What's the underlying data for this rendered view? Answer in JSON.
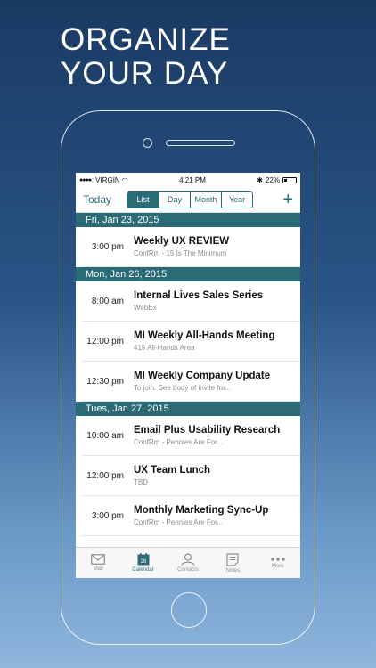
{
  "promo": {
    "line1": "ORGANIZE",
    "line2": "YOUR DAY"
  },
  "status": {
    "carrier": "VIRGIN",
    "time": "4:21 PM",
    "battery": "22%"
  },
  "toolbar": {
    "today": "Today",
    "views": [
      {
        "label": "List",
        "active": true
      },
      {
        "label": "Day",
        "active": false
      },
      {
        "label": "Month",
        "active": false
      },
      {
        "label": "Year",
        "active": false
      }
    ],
    "add": "+"
  },
  "days": [
    {
      "header": "Fri, Jan 23, 2015",
      "events": [
        {
          "time": "3:00 pm",
          "title": "Weekly UX REVIEW",
          "sub": "ConfRm - 15 Is The Minimum"
        }
      ]
    },
    {
      "header": "Mon, Jan 26, 2015",
      "events": [
        {
          "time": "8:00 am",
          "title": "Internal Lives Sales Series",
          "sub": "WebEx"
        },
        {
          "time": "12:00 pm",
          "title": "MI Weekly All-Hands Meeting",
          "sub": "415 All-Hands Area"
        },
        {
          "time": "12:30 pm",
          "title": "MI Weekly Company Update",
          "sub": "To join: See body of invite for..."
        }
      ]
    },
    {
      "header": "Tues, Jan 27, 2015",
      "events": [
        {
          "time": "10:00 am",
          "title": "Email Plus Usability Research",
          "sub": "ConfRm - Pennies Are For..."
        },
        {
          "time": "12:00 pm",
          "title": "UX Team Lunch",
          "sub": "TBD"
        },
        {
          "time": "3:00 pm",
          "title": "Monthly Marketing Sync-Up",
          "sub": "ConfRm - Pennies Are For..."
        }
      ]
    }
  ],
  "tabs": [
    {
      "label": "Mail",
      "icon": "mail-icon",
      "active": false
    },
    {
      "label": "Calendar",
      "icon": "calendar-icon",
      "active": true,
      "badge": "26"
    },
    {
      "label": "Contacts",
      "icon": "contacts-icon",
      "active": false
    },
    {
      "label": "Notes",
      "icon": "notes-icon",
      "active": false
    },
    {
      "label": "More",
      "icon": "more-icon",
      "active": false
    }
  ],
  "colors": {
    "accent": "#2a6b76",
    "bg_top": "#1a3a63",
    "bg_bottom": "#8fb6dc"
  }
}
